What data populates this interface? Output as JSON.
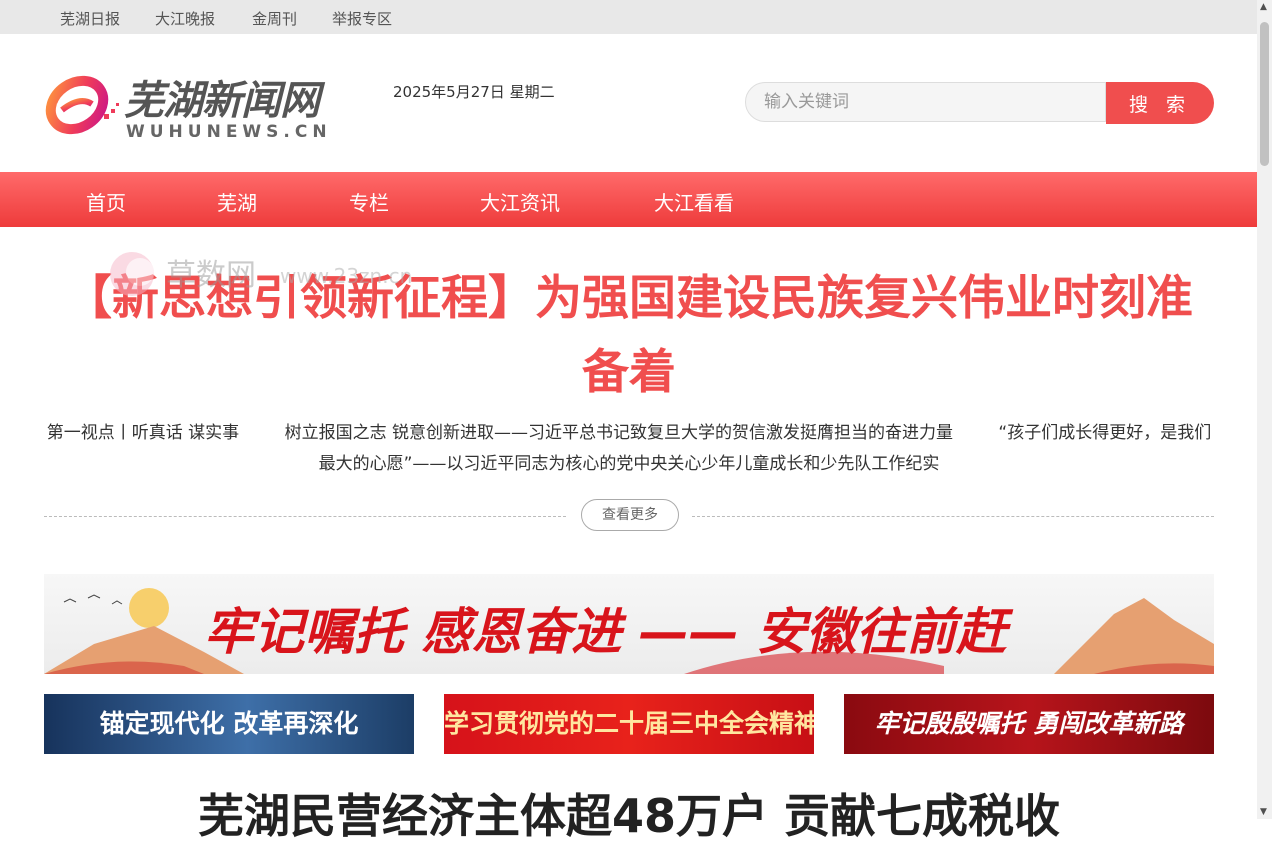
{
  "topbar": {
    "links": [
      "芜湖日报",
      "大江晚报",
      "金周刊",
      "举报专区"
    ]
  },
  "header": {
    "logo_text": "芜湖新闻网",
    "logo_subtext": "WUHUNEWS.CN",
    "date": "2025年5月27日  星期二",
    "search": {
      "placeholder": "输入关键词",
      "button_label": "搜 索"
    }
  },
  "nav": {
    "items": [
      "首页",
      "芜湖",
      "专栏",
      "大江资讯",
      "大江看看"
    ]
  },
  "watermark": {
    "text": "草数网",
    "url": "www.23zn.cn"
  },
  "main": {
    "headline": "【新思想引领新征程】为强国建设民族复兴伟业时刻准备着",
    "subnews": [
      "第一视点丨听真话 谋实事",
      "树立报国之志 锐意创新进取——习近平总书记致复旦大学的贺信激发挺膺担当的奋进力量",
      "“孩子们成长得更好，是我们最大的心愿”——以习近平同志为核心的党中央关心少年儿童成长和少先队工作纪实"
    ],
    "more_label": "查看更多"
  },
  "banners": {
    "main_text": "牢记嘱托 感恩奋进 —— 安徽往前赶",
    "sub": [
      "锚定现代化 改革再深化",
      "学习贯彻党的二十届三中全会精神",
      "牢记殷殷嘱托 勇闯改革新路"
    ]
  },
  "bottom_headline": "芜湖民营经济主体超48万户 贡献七成税收",
  "colors": {
    "accent": "#f04e4e",
    "nav_top": "#ff6a6a",
    "nav_bottom": "#ee3b3b"
  }
}
